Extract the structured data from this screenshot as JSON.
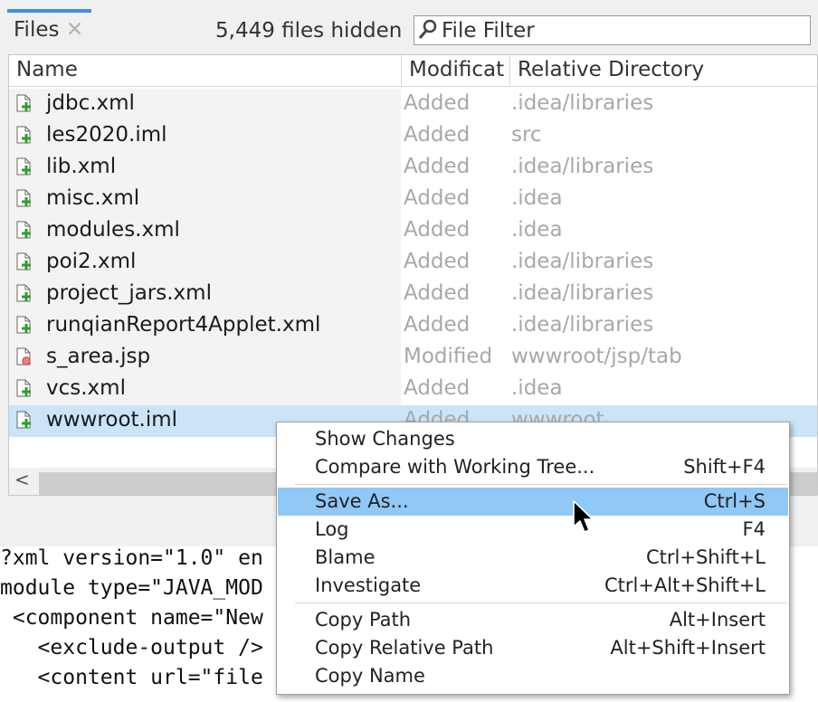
{
  "tab": {
    "label": "Files",
    "close_icon": "close-icon",
    "close_glyph": "✕"
  },
  "hidden_count": "5,449 files hidden",
  "filter": {
    "placeholder": "File Filter",
    "icon": "search-icon"
  },
  "table": {
    "columns": [
      "Name",
      "Modificat",
      "Relative Directory"
    ],
    "rows": [
      {
        "name": "jdbc.xml",
        "status": "Added",
        "dir": ".idea/libraries",
        "icon": "file-added-icon"
      },
      {
        "name": "les2020.iml",
        "status": "Added",
        "dir": "src",
        "icon": "file-added-icon"
      },
      {
        "name": "lib.xml",
        "status": "Added",
        "dir": ".idea/libraries",
        "icon": "file-added-icon"
      },
      {
        "name": "misc.xml",
        "status": "Added",
        "dir": ".idea",
        "icon": "file-added-icon"
      },
      {
        "name": "modules.xml",
        "status": "Added",
        "dir": ".idea",
        "icon": "file-added-icon"
      },
      {
        "name": "poi2.xml",
        "status": "Added",
        "dir": ".idea/libraries",
        "icon": "file-added-icon"
      },
      {
        "name": "project_jars.xml",
        "status": "Added",
        "dir": ".idea/libraries",
        "icon": "file-added-icon"
      },
      {
        "name": "runqianReport4Applet.xml",
        "status": "Added",
        "dir": ".idea/libraries",
        "icon": "file-added-icon"
      },
      {
        "name": "s_area.jsp",
        "status": "Modified",
        "dir": "wwwroot/jsp/tab",
        "icon": "file-modified-icon"
      },
      {
        "name": "vcs.xml",
        "status": "Added",
        "dir": ".idea",
        "icon": "file-added-icon"
      },
      {
        "name": "wwwroot.iml",
        "status": "Added",
        "dir": "wwwroot",
        "icon": "file-added-icon",
        "selected": true
      }
    ]
  },
  "code_lines": [
    "?xml version=\"1.0\" en",
    "module type=\"JAVA_MOD",
    " <component name=\"New",
    "   <exclude-output />",
    "   <content url=\"file"
  ],
  "context_menu": {
    "items": [
      {
        "label": "Show Changes",
        "shortcut": ""
      },
      {
        "label": "Compare with Working Tree...",
        "shortcut": "Shift+F4"
      },
      {
        "label": "Save As...",
        "shortcut": "Ctrl+S",
        "highlighted": true
      },
      {
        "label": "Log",
        "shortcut": "F4"
      },
      {
        "label": "Blame",
        "shortcut": "Ctrl+Shift+L"
      },
      {
        "label": "Investigate",
        "shortcut": "Ctrl+Alt+Shift+L"
      },
      {
        "label": "Copy Path",
        "shortcut": "Alt+Insert"
      },
      {
        "label": "Copy Relative Path",
        "shortcut": "Alt+Shift+Insert"
      },
      {
        "label": "Copy Name",
        "shortcut": ""
      }
    ]
  },
  "colors": {
    "accent": "#3d8ee8",
    "selection": "#cce4f7",
    "menu_highlight": "#90c8f6",
    "added_badge": "#2e9e2e",
    "modified_badge": "#e88080"
  }
}
